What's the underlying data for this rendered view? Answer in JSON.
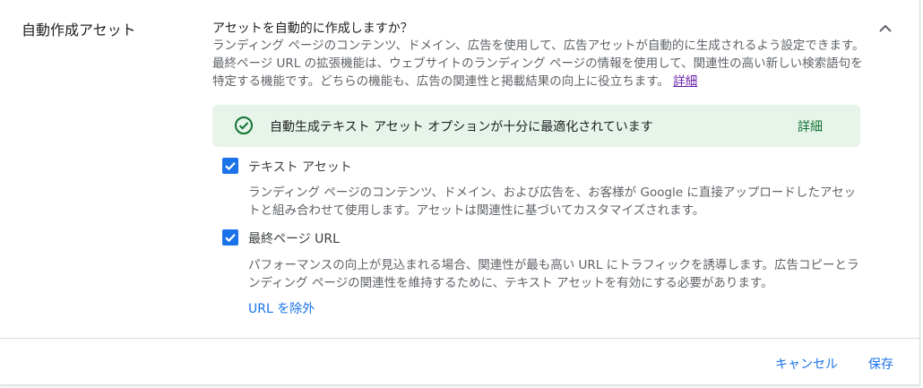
{
  "section": {
    "title": "自動作成アセット"
  },
  "main": {
    "question": "アセットを自動的に作成しますか？",
    "description": "ランディング ページのコンテンツ、ドメイン、広告を使用して、広告アセットが自動的に生成されるよう設定できます。最終ページ URL の拡張機能は、ウェブサイトのランディング ページの情報を使用して、関連性の高い新しい検索語句を特定する機能です。どちらの機能も、広告の関連性と掲載結果の向上に役立ちます。",
    "description_link": "詳細"
  },
  "banner": {
    "text": "自動生成テキスト アセット オプションが十分に最適化されています",
    "link": "詳細"
  },
  "options": [
    {
      "label": "テキスト アセット",
      "checked": true,
      "description": "ランディング ページのコンテンツ、ドメイン、および広告を、お客様が Google に直接アップロードしたアセットと組み合わせて使用します。アセットは関連性に基づいてカスタマイズされます。"
    },
    {
      "label": "最終ページ URL",
      "checked": true,
      "description": "パフォーマンスの向上が見込まれる場合、関連性が最も高い URL にトラフィックを誘導します。広告コピーとランディング ページの関連性を維持するために、テキスト アセットを有効にする必要があります。"
    }
  ],
  "exclude_link": "URL を除外",
  "footer": {
    "cancel": "キャンセル",
    "save": "保存"
  },
  "colors": {
    "accent": "#1a73e8",
    "success_bg": "#e6f4ea",
    "success": "#137333",
    "visited_link": "#681da8"
  }
}
